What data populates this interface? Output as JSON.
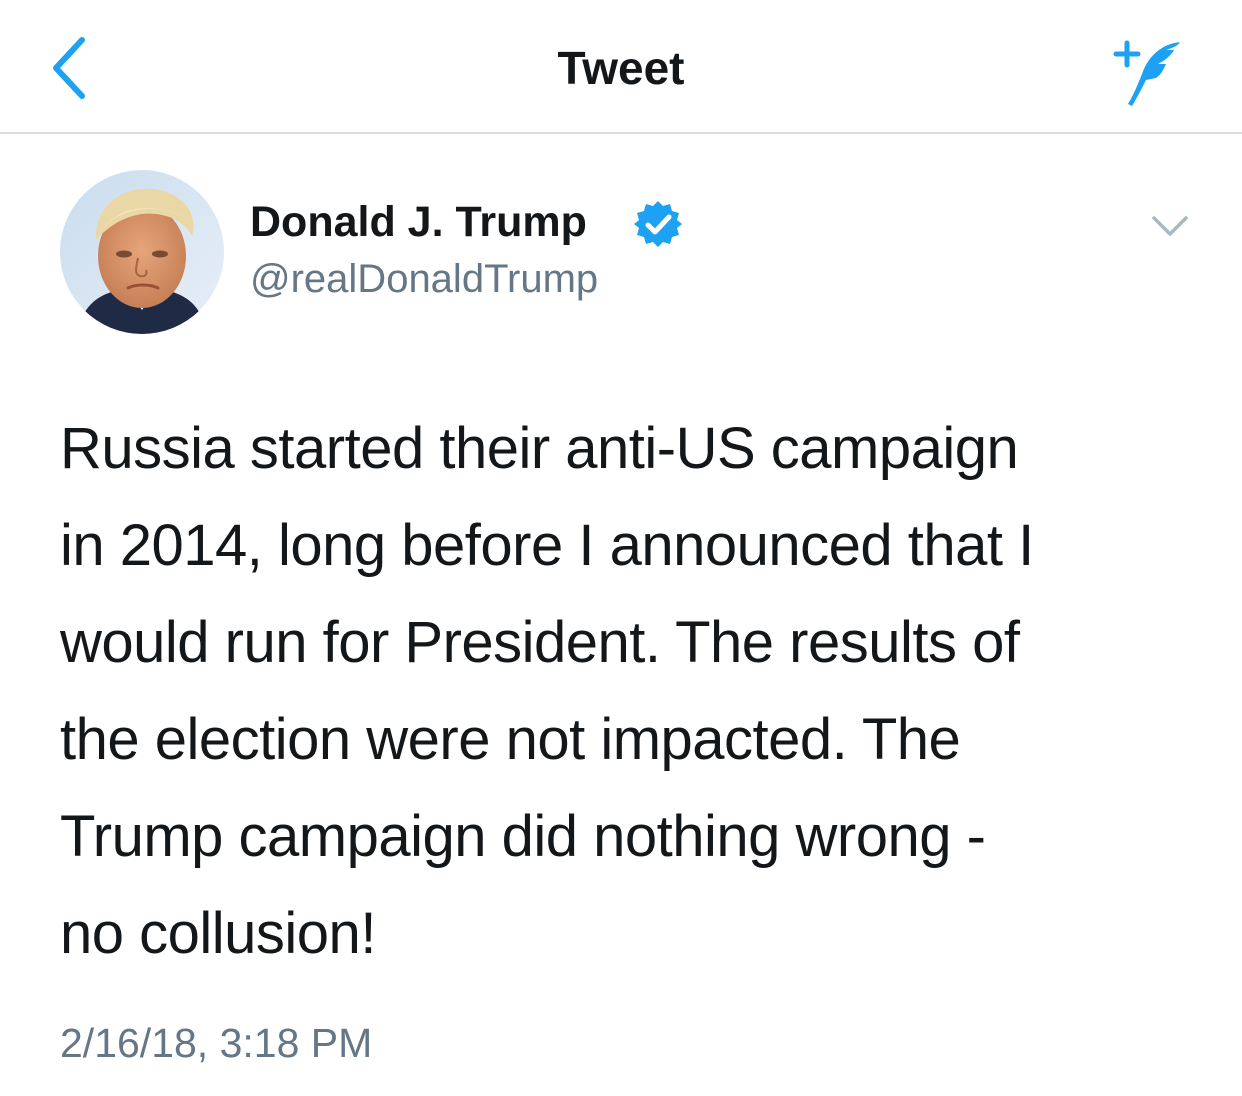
{
  "nav": {
    "title": "Tweet",
    "back_icon": "chevron-left-icon",
    "compose_icon": "compose-tweet-icon",
    "accent_color": "#1da1f2"
  },
  "tweet": {
    "author": {
      "name": "Donald J. Trump",
      "handle": "@realDonaldTrump",
      "verified": true,
      "verified_icon": "verified-badge-icon"
    },
    "more_icon": "chevron-down-icon",
    "text_lines": [
      "Russia started their anti-US campaign",
      "in 2014, long before I announced that I",
      "would run for President. The results of",
      "the election were not impacted. The",
      "Trump campaign did nothing wrong -",
      "no collusion!"
    ],
    "timestamp": "2/16/18, 3:18 PM"
  }
}
